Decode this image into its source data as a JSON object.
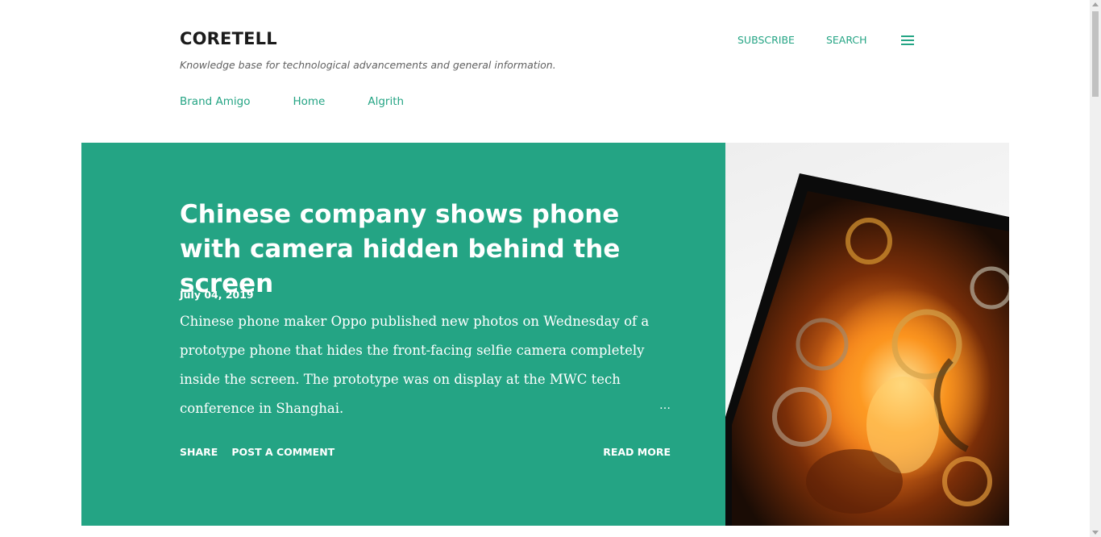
{
  "header": {
    "blog_title": "CORETELL",
    "description": "Knowledge base for technological advancements and general information.",
    "subscribe_label": "SUBSCRIBE",
    "search_label": "SEARCH",
    "menu_icon": "hamburger-menu-icon"
  },
  "nav": {
    "items": [
      {
        "label": "Brand Amigo"
      },
      {
        "label": "Home"
      },
      {
        "label": "Algrith"
      }
    ]
  },
  "post": {
    "title": "Chinese company shows phone with camera hidden behind the screen",
    "date": "July 04, 2019",
    "snippet": "Chinese phone maker Oppo published new photos on Wednesday of a prototype phone that hides the front-facing selfie camera completely inside the screen. The prototype was on display at the MWC tech conference in Shanghai.",
    "ellipsis": "…",
    "share_label": "SHARE",
    "comment_label": "POST A COMMENT",
    "read_more_label": "READ MORE"
  },
  "colors": {
    "accent": "#24a484",
    "title_text": "#1b1b1b",
    "description_text": "#616161",
    "hero_background": "#24a484"
  }
}
